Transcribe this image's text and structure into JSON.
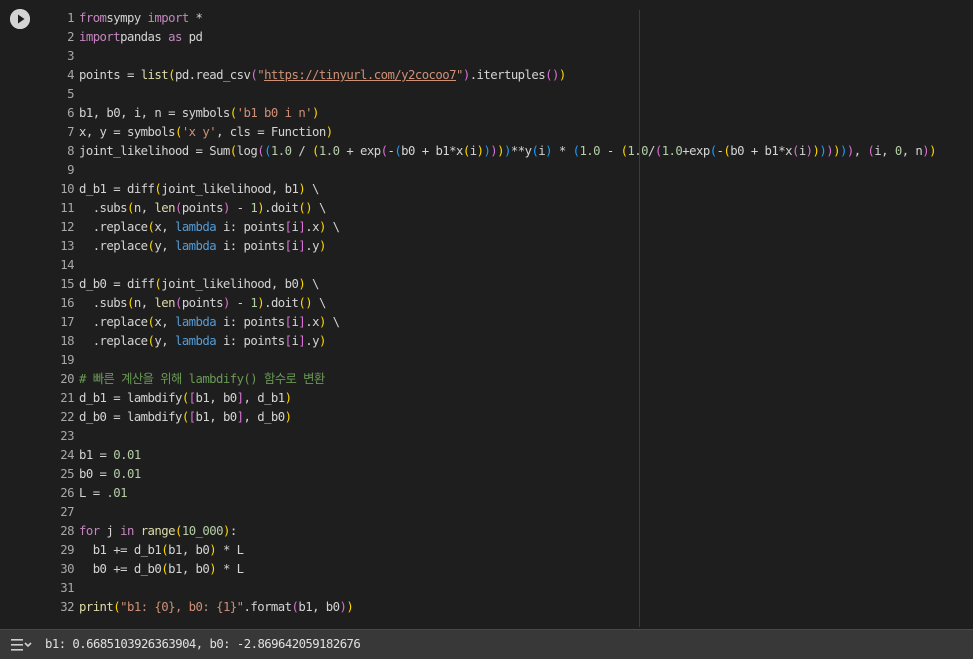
{
  "cell": {
    "run_label": "run-cell",
    "lines": [
      {
        "n": "1",
        "segs": [
          [
            "kw",
            "from"
          ],
          [
            "",
            "sympy "
          ],
          [
            "kw",
            "import"
          ],
          [
            "",
            " *"
          ]
        ]
      },
      {
        "n": "2",
        "segs": [
          [
            "kw",
            "import"
          ],
          [
            "",
            "pandas "
          ],
          [
            "kw",
            "as"
          ],
          [
            "",
            " pd"
          ]
        ]
      },
      {
        "n": "3",
        "segs": []
      },
      {
        "n": "4",
        "segs": [
          [
            "",
            "points = "
          ],
          [
            "fn",
            "list"
          ],
          [
            "p1",
            "("
          ],
          [
            "",
            "pd.read_csv"
          ],
          [
            "p2",
            "("
          ],
          [
            "str",
            "\""
          ],
          [
            "url",
            "https://tinyurl.com/y2cocoo7"
          ],
          [
            "str",
            "\""
          ],
          [
            "p2",
            ")"
          ],
          [
            "",
            ".itertuples"
          ],
          [
            "p2",
            "()"
          ],
          [
            "p1",
            ")"
          ]
        ]
      },
      {
        "n": "5",
        "segs": []
      },
      {
        "n": "6",
        "segs": [
          [
            "",
            "b1, b0, i, n = symbols"
          ],
          [
            "p1",
            "("
          ],
          [
            "str",
            "'b1 b0 i n'"
          ],
          [
            "p1",
            ")"
          ]
        ]
      },
      {
        "n": "7",
        "segs": [
          [
            "",
            "x, y = symbols"
          ],
          [
            "p1",
            "("
          ],
          [
            "str",
            "'x y'"
          ],
          [
            "",
            ", cls = Function"
          ],
          [
            "p1",
            ")"
          ]
        ]
      },
      {
        "n": "8",
        "segs": [
          [
            "",
            "joint_likelihood = Sum"
          ],
          [
            "p1",
            "("
          ],
          [
            "",
            "log"
          ],
          [
            "p2",
            "("
          ],
          [
            "p3",
            "("
          ],
          [
            "num",
            "1.0"
          ],
          [
            "",
            " / "
          ],
          [
            "p1",
            "("
          ],
          [
            "num",
            "1.0"
          ],
          [
            "",
            " + exp"
          ],
          [
            "p2",
            "("
          ],
          [
            "",
            "-"
          ],
          [
            "p3",
            "("
          ],
          [
            "",
            "b0 + b1*x"
          ],
          [
            "p1",
            "("
          ],
          [
            "",
            "i"
          ],
          [
            "p1",
            ")"
          ],
          [
            "p3",
            ")"
          ],
          [
            "p2",
            ")"
          ],
          [
            "p1",
            ")"
          ],
          [
            "p3",
            ")"
          ],
          [
            "",
            "**y"
          ],
          [
            "p3",
            "("
          ],
          [
            "",
            "i"
          ],
          [
            "p3",
            ")"
          ],
          [
            "",
            " * "
          ],
          [
            "p3",
            "("
          ],
          [
            "num",
            "1.0"
          ],
          [
            "",
            " - "
          ],
          [
            "p1",
            "("
          ],
          [
            "num",
            "1.0"
          ],
          [
            "",
            "/"
          ],
          [
            "p2",
            "("
          ],
          [
            "num",
            "1.0"
          ],
          [
            "",
            "+exp"
          ],
          [
            "p3",
            "("
          ],
          [
            "",
            "-"
          ],
          [
            "p1",
            "("
          ],
          [
            "",
            "b0 + b1*x"
          ],
          [
            "p2",
            "("
          ],
          [
            "",
            "i"
          ],
          [
            "p2",
            ")"
          ],
          [
            "p1",
            ")"
          ],
          [
            "p3",
            ")"
          ],
          [
            "p2",
            ")"
          ],
          [
            "p1",
            ")"
          ],
          [
            "p3",
            ")"
          ],
          [
            "p2",
            ")"
          ],
          [
            "",
            ", "
          ],
          [
            "p2",
            "("
          ],
          [
            "",
            "i, "
          ],
          [
            "num",
            "0"
          ],
          [
            "",
            ", n"
          ],
          [
            "p2",
            ")"
          ],
          [
            "p1",
            ")"
          ]
        ]
      },
      {
        "n": "9",
        "segs": []
      },
      {
        "n": "10",
        "segs": [
          [
            "",
            "d_b1 = diff"
          ],
          [
            "p1",
            "("
          ],
          [
            "",
            "joint_likelihood, b1"
          ],
          [
            "p1",
            ")"
          ],
          [
            "",
            " \\"
          ]
        ]
      },
      {
        "n": "11",
        "segs": [
          [
            "",
            "  .subs"
          ],
          [
            "p1",
            "("
          ],
          [
            "",
            "n, "
          ],
          [
            "fn",
            "len"
          ],
          [
            "p2",
            "("
          ],
          [
            "",
            "points"
          ],
          [
            "p2",
            ")"
          ],
          [
            "",
            " - "
          ],
          [
            "num",
            "1"
          ],
          [
            "p1",
            ")"
          ],
          [
            "",
            ".doit"
          ],
          [
            "p1",
            "()"
          ],
          [
            "",
            " \\"
          ]
        ]
      },
      {
        "n": "12",
        "segs": [
          [
            "",
            "  .replace"
          ],
          [
            "p1",
            "("
          ],
          [
            "",
            "x, "
          ],
          [
            "kwb",
            "lambda"
          ],
          [
            "",
            " i: points"
          ],
          [
            "p2",
            "["
          ],
          [
            "",
            "i"
          ],
          [
            "p2",
            "]"
          ],
          [
            "",
            ".x"
          ],
          [
            "p1",
            ")"
          ],
          [
            "",
            " \\"
          ]
        ]
      },
      {
        "n": "13",
        "segs": [
          [
            "",
            "  .replace"
          ],
          [
            "p1",
            "("
          ],
          [
            "",
            "y, "
          ],
          [
            "kwb",
            "lambda"
          ],
          [
            "",
            " i: points"
          ],
          [
            "p2",
            "["
          ],
          [
            "",
            "i"
          ],
          [
            "p2",
            "]"
          ],
          [
            "",
            ".y"
          ],
          [
            "p1",
            ")"
          ]
        ]
      },
      {
        "n": "14",
        "segs": []
      },
      {
        "n": "15",
        "segs": [
          [
            "",
            "d_b0 = diff"
          ],
          [
            "p1",
            "("
          ],
          [
            "",
            "joint_likelihood, b0"
          ],
          [
            "p1",
            ")"
          ],
          [
            "",
            " \\"
          ]
        ]
      },
      {
        "n": "16",
        "segs": [
          [
            "",
            "  .subs"
          ],
          [
            "p1",
            "("
          ],
          [
            "",
            "n, "
          ],
          [
            "fn",
            "len"
          ],
          [
            "p2",
            "("
          ],
          [
            "",
            "points"
          ],
          [
            "p2",
            ")"
          ],
          [
            "",
            " - "
          ],
          [
            "num",
            "1"
          ],
          [
            "p1",
            ")"
          ],
          [
            "",
            ".doit"
          ],
          [
            "p1",
            "()"
          ],
          [
            "",
            " \\"
          ]
        ]
      },
      {
        "n": "17",
        "segs": [
          [
            "",
            "  .replace"
          ],
          [
            "p1",
            "("
          ],
          [
            "",
            "x, "
          ],
          [
            "kwb",
            "lambda"
          ],
          [
            "",
            " i: points"
          ],
          [
            "p2",
            "["
          ],
          [
            "",
            "i"
          ],
          [
            "p2",
            "]"
          ],
          [
            "",
            ".x"
          ],
          [
            "p1",
            ")"
          ],
          [
            "",
            " \\"
          ]
        ]
      },
      {
        "n": "18",
        "segs": [
          [
            "",
            "  .replace"
          ],
          [
            "p1",
            "("
          ],
          [
            "",
            "y, "
          ],
          [
            "kwb",
            "lambda"
          ],
          [
            "",
            " i: points"
          ],
          [
            "p2",
            "["
          ],
          [
            "",
            "i"
          ],
          [
            "p2",
            "]"
          ],
          [
            "",
            ".y"
          ],
          [
            "p1",
            ")"
          ]
        ]
      },
      {
        "n": "19",
        "segs": []
      },
      {
        "n": "20",
        "segs": [
          [
            "cm",
            "# 빠른 계산을 위해 lambdify() 함수로 변환"
          ]
        ]
      },
      {
        "n": "21",
        "segs": [
          [
            "",
            "d_b1 = lambdify"
          ],
          [
            "p1",
            "("
          ],
          [
            "p2",
            "["
          ],
          [
            "",
            "b1, b0"
          ],
          [
            "p2",
            "]"
          ],
          [
            "",
            ", d_b1"
          ],
          [
            "p1",
            ")"
          ]
        ]
      },
      {
        "n": "22",
        "segs": [
          [
            "",
            "d_b0 = lambdify"
          ],
          [
            "p1",
            "("
          ],
          [
            "p2",
            "["
          ],
          [
            "",
            "b1, b0"
          ],
          [
            "p2",
            "]"
          ],
          [
            "",
            ", d_b0"
          ],
          [
            "p1",
            ")"
          ]
        ]
      },
      {
        "n": "23",
        "segs": []
      },
      {
        "n": "24",
        "segs": [
          [
            "",
            "b1 = "
          ],
          [
            "num",
            "0.01"
          ]
        ]
      },
      {
        "n": "25",
        "segs": [
          [
            "",
            "b0 = "
          ],
          [
            "num",
            "0.01"
          ]
        ]
      },
      {
        "n": "26",
        "segs": [
          [
            "",
            "L = "
          ],
          [
            "num",
            ".01"
          ]
        ]
      },
      {
        "n": "27",
        "segs": []
      },
      {
        "n": "28",
        "segs": [
          [
            "kw",
            "for"
          ],
          [
            "",
            " j "
          ],
          [
            "kw",
            "in"
          ],
          [
            "",
            " "
          ],
          [
            "fn",
            "range"
          ],
          [
            "p1",
            "("
          ],
          [
            "num",
            "10_000"
          ],
          [
            "p1",
            ")"
          ],
          [
            "",
            ":"
          ]
        ]
      },
      {
        "n": "29",
        "segs": [
          [
            "",
            "  b1 += d_b1"
          ],
          [
            "p1",
            "("
          ],
          [
            "",
            "b1, b0"
          ],
          [
            "p1",
            ")"
          ],
          [
            "",
            " * L"
          ]
        ]
      },
      {
        "n": "30",
        "segs": [
          [
            "",
            "  b0 += d_b0"
          ],
          [
            "p1",
            "("
          ],
          [
            "",
            "b1, b0"
          ],
          [
            "p1",
            ")"
          ],
          [
            "",
            " * L"
          ]
        ]
      },
      {
        "n": "31",
        "segs": []
      },
      {
        "n": "32",
        "segs": [
          [
            "fn",
            "print"
          ],
          [
            "p1",
            "("
          ],
          [
            "str",
            "\"b1: {0}, b0: {1}\""
          ],
          [
            "",
            ".format"
          ],
          [
            "p2",
            "("
          ],
          [
            "",
            "b1, b0"
          ],
          [
            "p2",
            ")"
          ],
          [
            "p1",
            ")"
          ]
        ]
      }
    ]
  },
  "output": {
    "text": "b1: 0.6685103926363904, b0: -2.869642059182676"
  }
}
